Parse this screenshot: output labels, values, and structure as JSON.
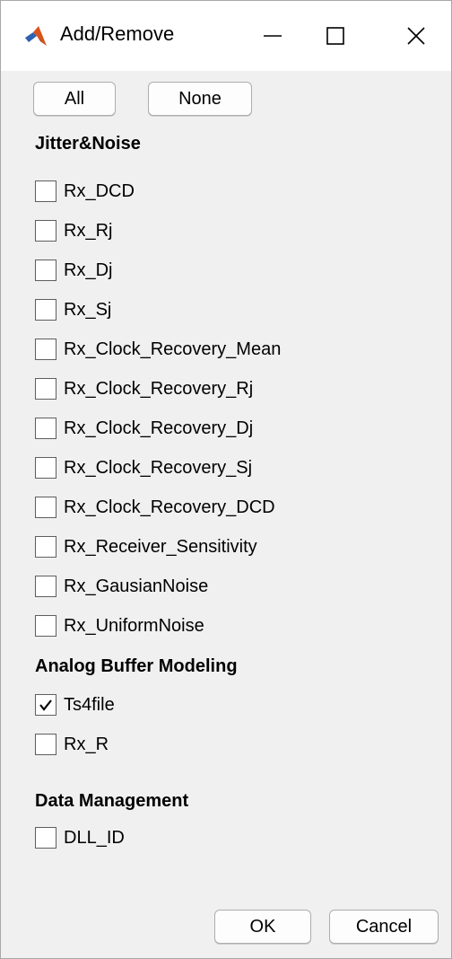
{
  "window": {
    "title": "Add/Remove"
  },
  "buttons": {
    "all": "All",
    "none": "None",
    "ok": "OK",
    "cancel": "Cancel"
  },
  "sections": [
    {
      "title": "Jitter&Noise",
      "items": [
        {
          "label": "Rx_DCD",
          "checked": false
        },
        {
          "label": "Rx_Rj",
          "checked": false
        },
        {
          "label": "Rx_Dj",
          "checked": false
        },
        {
          "label": "Rx_Sj",
          "checked": false
        },
        {
          "label": "Rx_Clock_Recovery_Mean",
          "checked": false
        },
        {
          "label": "Rx_Clock_Recovery_Rj",
          "checked": false
        },
        {
          "label": "Rx_Clock_Recovery_Dj",
          "checked": false
        },
        {
          "label": "Rx_Clock_Recovery_Sj",
          "checked": false
        },
        {
          "label": "Rx_Clock_Recovery_DCD",
          "checked": false
        },
        {
          "label": "Rx_Receiver_Sensitivity",
          "checked": false
        },
        {
          "label": "Rx_GausianNoise",
          "checked": false
        },
        {
          "label": "Rx_UniformNoise",
          "checked": false
        }
      ]
    },
    {
      "title": "Analog Buffer Modeling",
      "items": [
        {
          "label": "Ts4file",
          "checked": true
        },
        {
          "label": "Rx_R",
          "checked": false
        }
      ]
    },
    {
      "title": "Data Management",
      "items": [
        {
          "label": "DLL_ID",
          "checked": false
        }
      ]
    }
  ],
  "colors": {
    "titlebar": "#ffffff",
    "client": "#f0f0f0",
    "matlab_icon_orange": "#d95319",
    "matlab_icon_blue": "#2c62b2"
  },
  "icons": {
    "app": "matlab-icon",
    "minimize": "minimize-icon",
    "maximize": "maximize-icon",
    "close": "close-icon",
    "check": "checkmark-icon"
  }
}
